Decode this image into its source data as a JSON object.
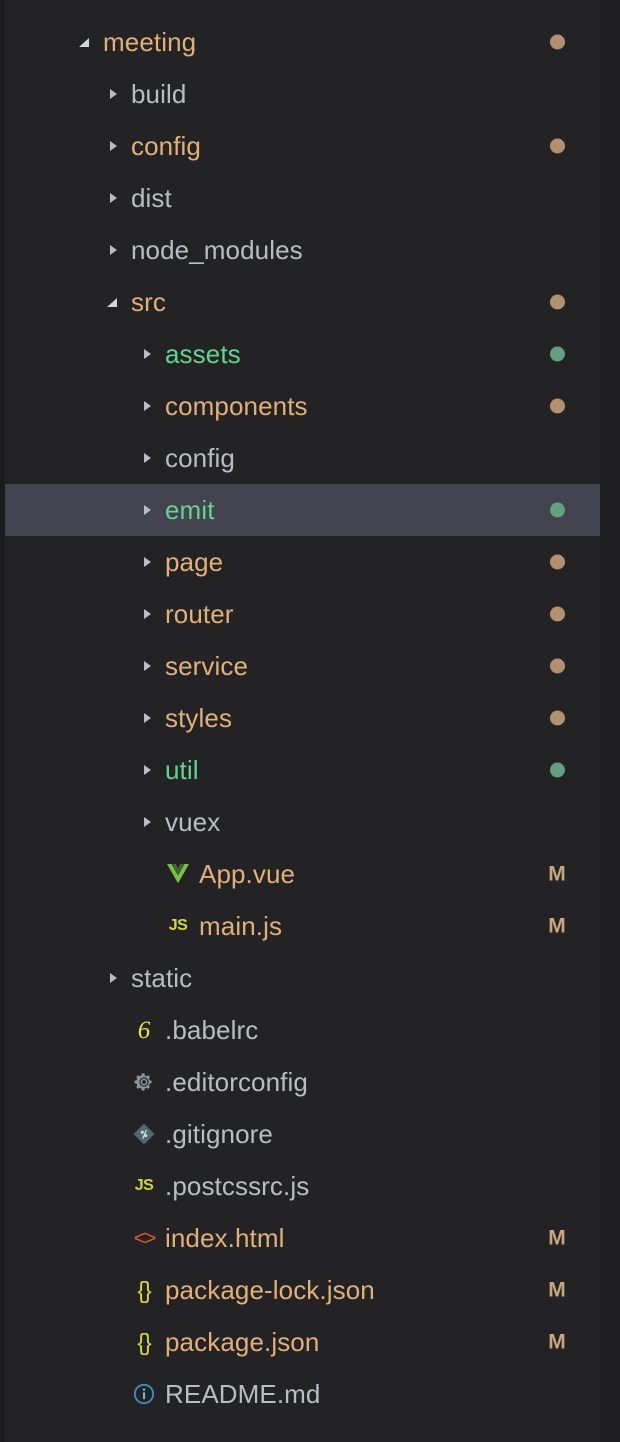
{
  "theme": {
    "background": "#1e1e20",
    "panel_background": "#232326",
    "selected_row_background": "#43424f",
    "color_plain": "#b9bdc2",
    "color_modified": "#e2b077",
    "color_new": "#62d58c",
    "dot_modified": "#b58f71",
    "dot_new": "#63a07c",
    "marker_color": "#c7a67e"
  },
  "tree": {
    "root_label": "meeting",
    "items": [
      {
        "label": "meeting",
        "type": "folder",
        "state": "expanded",
        "indent": 0,
        "color": "modified",
        "icon": "",
        "status": "dot-modified"
      },
      {
        "label": "build",
        "type": "folder",
        "state": "collapsed",
        "indent": 1,
        "color": "plain",
        "icon": "",
        "status": ""
      },
      {
        "label": "config",
        "type": "folder",
        "state": "collapsed",
        "indent": 1,
        "color": "modified",
        "icon": "",
        "status": "dot-modified"
      },
      {
        "label": "dist",
        "type": "folder",
        "state": "collapsed",
        "indent": 1,
        "color": "plain",
        "icon": "",
        "status": ""
      },
      {
        "label": "node_modules",
        "type": "folder",
        "state": "collapsed",
        "indent": 1,
        "color": "plain",
        "icon": "",
        "status": ""
      },
      {
        "label": "src",
        "type": "folder",
        "state": "expanded",
        "indent": 1,
        "color": "modified",
        "icon": "",
        "status": "dot-modified"
      },
      {
        "label": "assets",
        "type": "folder",
        "state": "collapsed",
        "indent": 2,
        "color": "new",
        "icon": "",
        "status": "dot-new"
      },
      {
        "label": "components",
        "type": "folder",
        "state": "collapsed",
        "indent": 2,
        "color": "modified",
        "icon": "",
        "status": "dot-modified"
      },
      {
        "label": "config",
        "type": "folder",
        "state": "collapsed",
        "indent": 2,
        "color": "plain",
        "icon": "",
        "status": ""
      },
      {
        "label": "emit",
        "type": "folder",
        "state": "collapsed",
        "indent": 2,
        "color": "new",
        "icon": "",
        "status": "dot-new",
        "selected": true
      },
      {
        "label": "page",
        "type": "folder",
        "state": "collapsed",
        "indent": 2,
        "color": "modified",
        "icon": "",
        "status": "dot-modified"
      },
      {
        "label": "router",
        "type": "folder",
        "state": "collapsed",
        "indent": 2,
        "color": "modified",
        "icon": "",
        "status": "dot-modified"
      },
      {
        "label": "service",
        "type": "folder",
        "state": "collapsed",
        "indent": 2,
        "color": "modified",
        "icon": "",
        "status": "dot-modified"
      },
      {
        "label": "styles",
        "type": "folder",
        "state": "collapsed",
        "indent": 2,
        "color": "modified",
        "icon": "",
        "status": "dot-modified"
      },
      {
        "label": "util",
        "type": "folder",
        "state": "collapsed",
        "indent": 2,
        "color": "new",
        "icon": "",
        "status": "dot-new"
      },
      {
        "label": "vuex",
        "type": "folder",
        "state": "collapsed",
        "indent": 2,
        "color": "plain",
        "icon": "",
        "status": ""
      },
      {
        "label": "App.vue",
        "type": "file",
        "state": "none",
        "indent": 2,
        "color": "modified",
        "icon": "vue-icon",
        "status": "M"
      },
      {
        "label": "main.js",
        "type": "file",
        "state": "none",
        "indent": 2,
        "color": "modified",
        "icon": "js-icon",
        "status": "M"
      },
      {
        "label": "static",
        "type": "folder",
        "state": "collapsed",
        "indent": 1,
        "color": "plain",
        "icon": "",
        "status": ""
      },
      {
        "label": ".babelrc",
        "type": "file",
        "state": "none",
        "indent": 1,
        "color": "plain",
        "icon": "babel-icon",
        "status": ""
      },
      {
        "label": ".editorconfig",
        "type": "file",
        "state": "none",
        "indent": 1,
        "color": "plain",
        "icon": "gear-icon",
        "status": ""
      },
      {
        "label": ".gitignore",
        "type": "file",
        "state": "none",
        "indent": 1,
        "color": "plain",
        "icon": "git-icon",
        "status": ""
      },
      {
        "label": ".postcssrc.js",
        "type": "file",
        "state": "none",
        "indent": 1,
        "color": "plain",
        "icon": "js-icon",
        "status": ""
      },
      {
        "label": "index.html",
        "type": "file",
        "state": "none",
        "indent": 1,
        "color": "modified",
        "icon": "html-icon",
        "status": "M"
      },
      {
        "label": "package-lock.json",
        "type": "file",
        "state": "none",
        "indent": 1,
        "color": "modified",
        "icon": "json-icon",
        "status": "M"
      },
      {
        "label": "package.json",
        "type": "file",
        "state": "none",
        "indent": 1,
        "color": "modified",
        "icon": "json-icon",
        "status": "M"
      },
      {
        "label": "README.md",
        "type": "file",
        "state": "none",
        "indent": 1,
        "color": "plain",
        "icon": "info-icon",
        "status": ""
      }
    ]
  },
  "icon_glyphs": {
    "js-icon": "JS",
    "json-icon": "{}",
    "html-icon": "<>",
    "babel-icon": "6"
  },
  "status_glyphs": {
    "M": "M"
  }
}
